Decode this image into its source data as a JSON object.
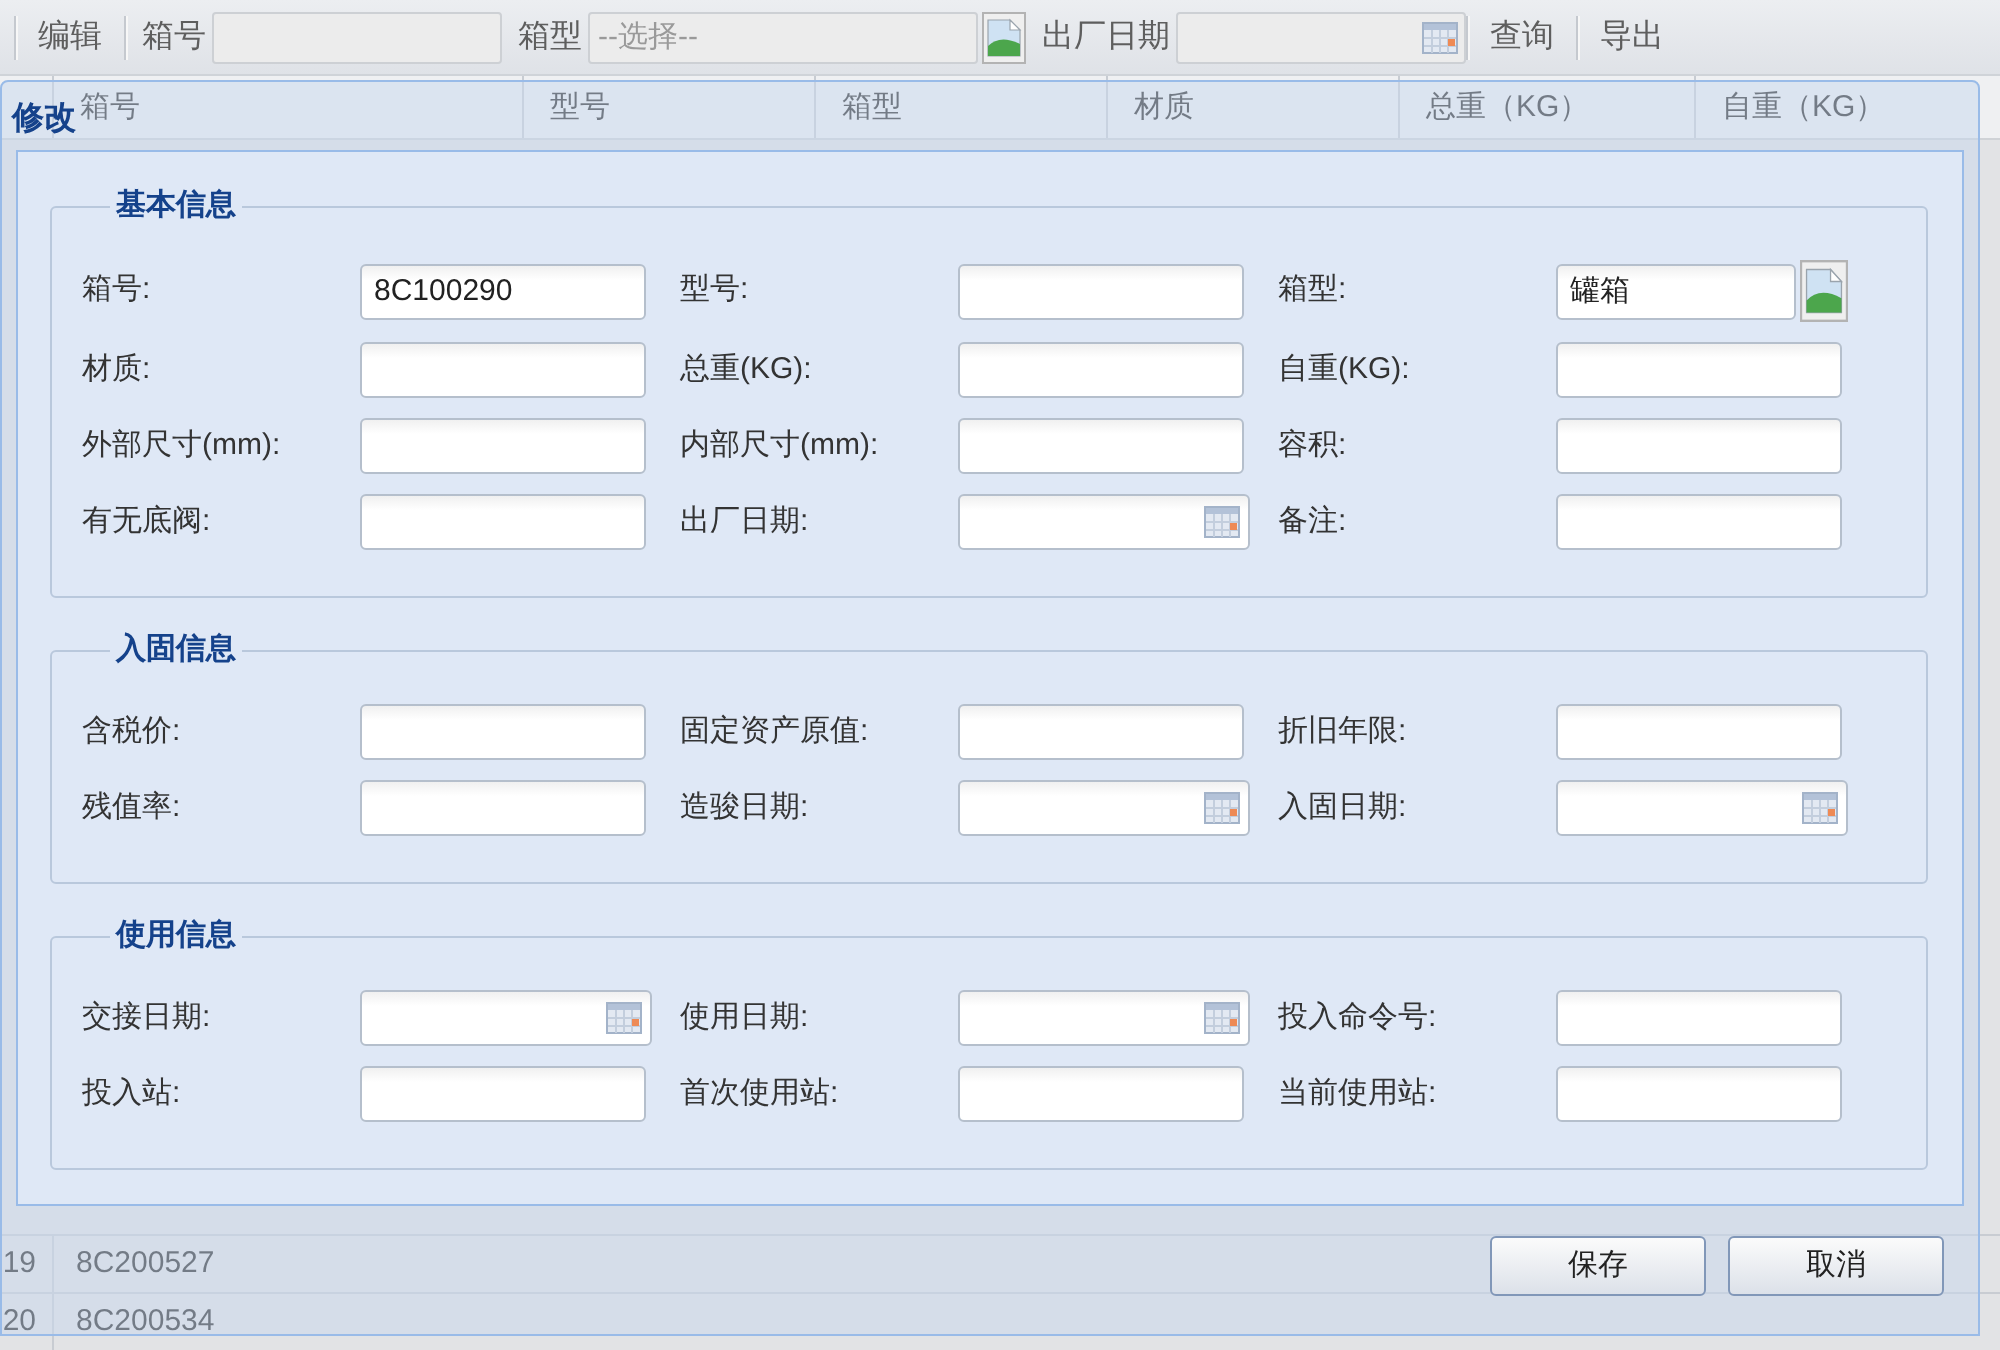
{
  "toolbar": [
    {
      "kind": "button",
      "label": "编辑"
    },
    {
      "kind": "field",
      "label": "箱号"
    },
    {
      "kind": "select",
      "label": "箱型",
      "placeholder": "--选择--"
    },
    {
      "kind": "date",
      "label": "出厂日期"
    },
    {
      "kind": "button",
      "label": "查询"
    },
    {
      "kind": "button",
      "label": "导出"
    }
  ],
  "grid": {
    "columns": [
      "箱号",
      "型号",
      "箱型",
      "材质",
      "总重（KG）",
      "自重（KG）"
    ],
    "rows": [
      {
        "number": "19",
        "cells": [
          "8C200527"
        ]
      },
      {
        "number": "20",
        "cells": [
          "8C200534"
        ]
      }
    ]
  },
  "dialog": {
    "title": "修改",
    "sections": [
      {
        "legend": "基本信息",
        "fields": [
          {
            "label": "箱号:",
            "kind": "text",
            "value": "8C100290"
          },
          {
            "label": "型号:",
            "kind": "text"
          },
          {
            "label": "箱型:",
            "kind": "select",
            "value": "罐箱"
          },
          {
            "label": "材质:",
            "kind": "text"
          },
          {
            "label": "总重(KG):",
            "kind": "text"
          },
          {
            "label": "自重(KG):",
            "kind": "text"
          },
          {
            "label": "外部尺寸(mm):",
            "kind": "text"
          },
          {
            "label": "内部尺寸(mm):",
            "kind": "text"
          },
          {
            "label": "容积:",
            "kind": "text"
          },
          {
            "label": "有无底阀:",
            "kind": "text"
          },
          {
            "label": "出厂日期:",
            "kind": "date"
          },
          {
            "label": "备注:",
            "kind": "text"
          }
        ]
      },
      {
        "legend": "入固信息",
        "fields": [
          {
            "label": "含税价:",
            "kind": "text"
          },
          {
            "label": "固定资产原值:",
            "kind": "text"
          },
          {
            "label": "折旧年限:",
            "kind": "text"
          },
          {
            "label": "残值率:",
            "kind": "text"
          },
          {
            "label": "造骏日期:",
            "kind": "date"
          },
          {
            "label": "入固日期:",
            "kind": "date"
          }
        ]
      },
      {
        "legend": "使用信息",
        "fields": [
          {
            "label": "交接日期:",
            "kind": "date"
          },
          {
            "label": "使用日期:",
            "kind": "date"
          },
          {
            "label": "投入命令号:",
            "kind": "text"
          },
          {
            "label": "投入站:",
            "kind": "text"
          },
          {
            "label": "首次使用站:",
            "kind": "text"
          },
          {
            "label": "当前使用站:",
            "kind": "text"
          }
        ]
      }
    ],
    "buttons": [
      "保存",
      "取消"
    ]
  }
}
